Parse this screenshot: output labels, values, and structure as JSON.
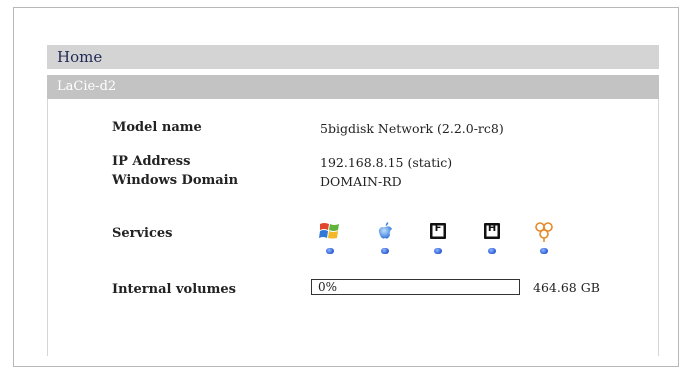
{
  "nav": {
    "home_label": "Home"
  },
  "device": {
    "name": "LaCie-d2"
  },
  "info": {
    "model_label": "Model name",
    "model_value": "5bigdisk Network (2.2.0-rc8)",
    "ip_label": "IP Address",
    "ip_value": "192.168.8.15 (static)",
    "domain_label": "Windows Domain",
    "domain_value": "DOMAIN-RD",
    "services_label": "Services",
    "volumes_label": "Internal volumes"
  },
  "services": [
    {
      "icon": "windows-icon",
      "status": "running"
    },
    {
      "icon": "apple-icon",
      "status": "running"
    },
    {
      "icon": "ftp-icon",
      "letter": "F",
      "status": "running"
    },
    {
      "icon": "http-icon",
      "letter": "H",
      "status": "running"
    },
    {
      "icon": "bittorrent-icon",
      "status": "running"
    }
  ],
  "volume": {
    "usage_text": "0%",
    "usage_fraction": 0,
    "size_text": "464.68 GB"
  },
  "colors": {
    "bar_home": "#d4d4d4",
    "bar_device": "#c3c3c3",
    "status_dot": "#2a5bd4"
  }
}
